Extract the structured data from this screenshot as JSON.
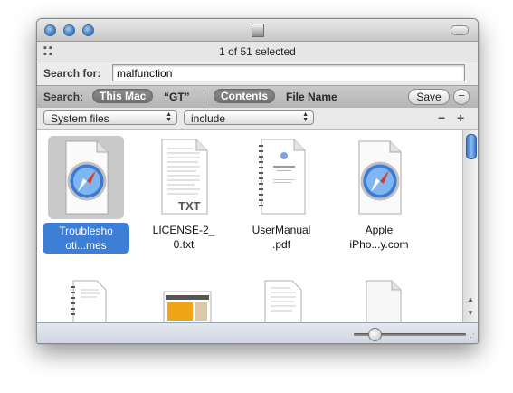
{
  "window": {
    "status_text": "1 of 51 selected"
  },
  "search": {
    "label": "Search for:",
    "query": "malfunction"
  },
  "scope": {
    "label": "Search:",
    "this_mac": "This Mac",
    "gt": "“GT”",
    "contents": "Contents",
    "file_name": "File Name",
    "save": "Save",
    "remove": "−"
  },
  "criteria": {
    "kind": "System files",
    "mode": "include",
    "minus": "−",
    "plus": "+"
  },
  "files": [
    {
      "line1": "Troublesho",
      "line2": "oti...mes",
      "icon": "safari-document-icon",
      "selected": true
    },
    {
      "line1": "LICENSE-2_",
      "line2": "0.txt",
      "icon": "text-document-icon",
      "badge": "TXT"
    },
    {
      "line1": "UserManual",
      "line2": ".pdf",
      "icon": "pdf-document-icon"
    },
    {
      "line1": "Apple",
      "line2": "iPho...y.com",
      "icon": "safari-document-icon"
    }
  ],
  "colors": {
    "selection": "#3d7ed6",
    "scope_pill": "#7f7f7f",
    "traffic_light": "#4c86c7"
  }
}
